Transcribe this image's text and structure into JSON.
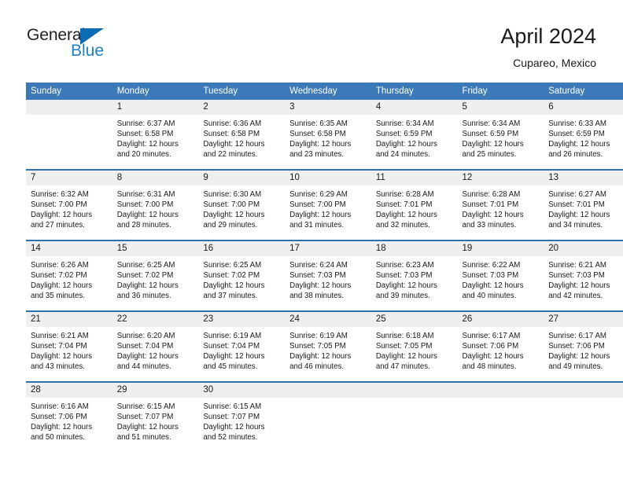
{
  "logo": {
    "word1": "General",
    "word2": "Blue",
    "triangle_color": "#0b6cb5",
    "word2_color": "#1c81c9"
  },
  "header": {
    "title": "April 2024",
    "subtitle": "Cupareo, Mexico",
    "accent_color": "#3b79b8",
    "daynum_band_color": "#efefef",
    "row_separator_color": "#2f6fae"
  },
  "calendar": {
    "weekday_headers": [
      "Sunday",
      "Monday",
      "Tuesday",
      "Wednesday",
      "Thursday",
      "Friday",
      "Saturday"
    ],
    "labels": {
      "sunrise": "Sunrise:",
      "sunset": "Sunset:",
      "daylight": "Daylight:"
    },
    "weeks": [
      [
        {
          "day": "",
          "empty": true
        },
        {
          "day": "1",
          "sunrise": "Sunrise: 6:37 AM",
          "sunset": "Sunset: 6:58 PM",
          "daylight_line1": "Daylight: 12 hours",
          "daylight_line2": "and 20 minutes."
        },
        {
          "day": "2",
          "sunrise": "Sunrise: 6:36 AM",
          "sunset": "Sunset: 6:58 PM",
          "daylight_line1": "Daylight: 12 hours",
          "daylight_line2": "and 22 minutes."
        },
        {
          "day": "3",
          "sunrise": "Sunrise: 6:35 AM",
          "sunset": "Sunset: 6:58 PM",
          "daylight_line1": "Daylight: 12 hours",
          "daylight_line2": "and 23 minutes."
        },
        {
          "day": "4",
          "sunrise": "Sunrise: 6:34 AM",
          "sunset": "Sunset: 6:59 PM",
          "daylight_line1": "Daylight: 12 hours",
          "daylight_line2": "and 24 minutes."
        },
        {
          "day": "5",
          "sunrise": "Sunrise: 6:34 AM",
          "sunset": "Sunset: 6:59 PM",
          "daylight_line1": "Daylight: 12 hours",
          "daylight_line2": "and 25 minutes."
        },
        {
          "day": "6",
          "sunrise": "Sunrise: 6:33 AM",
          "sunset": "Sunset: 6:59 PM",
          "daylight_line1": "Daylight: 12 hours",
          "daylight_line2": "and 26 minutes."
        }
      ],
      [
        {
          "day": "7",
          "sunrise": "Sunrise: 6:32 AM",
          "sunset": "Sunset: 7:00 PM",
          "daylight_line1": "Daylight: 12 hours",
          "daylight_line2": "and 27 minutes."
        },
        {
          "day": "8",
          "sunrise": "Sunrise: 6:31 AM",
          "sunset": "Sunset: 7:00 PM",
          "daylight_line1": "Daylight: 12 hours",
          "daylight_line2": "and 28 minutes."
        },
        {
          "day": "9",
          "sunrise": "Sunrise: 6:30 AM",
          "sunset": "Sunset: 7:00 PM",
          "daylight_line1": "Daylight: 12 hours",
          "daylight_line2": "and 29 minutes."
        },
        {
          "day": "10",
          "sunrise": "Sunrise: 6:29 AM",
          "sunset": "Sunset: 7:00 PM",
          "daylight_line1": "Daylight: 12 hours",
          "daylight_line2": "and 31 minutes."
        },
        {
          "day": "11",
          "sunrise": "Sunrise: 6:28 AM",
          "sunset": "Sunset: 7:01 PM",
          "daylight_line1": "Daylight: 12 hours",
          "daylight_line2": "and 32 minutes."
        },
        {
          "day": "12",
          "sunrise": "Sunrise: 6:28 AM",
          "sunset": "Sunset: 7:01 PM",
          "daylight_line1": "Daylight: 12 hours",
          "daylight_line2": "and 33 minutes."
        },
        {
          "day": "13",
          "sunrise": "Sunrise: 6:27 AM",
          "sunset": "Sunset: 7:01 PM",
          "daylight_line1": "Daylight: 12 hours",
          "daylight_line2": "and 34 minutes."
        }
      ],
      [
        {
          "day": "14",
          "sunrise": "Sunrise: 6:26 AM",
          "sunset": "Sunset: 7:02 PM",
          "daylight_line1": "Daylight: 12 hours",
          "daylight_line2": "and 35 minutes."
        },
        {
          "day": "15",
          "sunrise": "Sunrise: 6:25 AM",
          "sunset": "Sunset: 7:02 PM",
          "daylight_line1": "Daylight: 12 hours",
          "daylight_line2": "and 36 minutes."
        },
        {
          "day": "16",
          "sunrise": "Sunrise: 6:25 AM",
          "sunset": "Sunset: 7:02 PM",
          "daylight_line1": "Daylight: 12 hours",
          "daylight_line2": "and 37 minutes."
        },
        {
          "day": "17",
          "sunrise": "Sunrise: 6:24 AM",
          "sunset": "Sunset: 7:03 PM",
          "daylight_line1": "Daylight: 12 hours",
          "daylight_line2": "and 38 minutes."
        },
        {
          "day": "18",
          "sunrise": "Sunrise: 6:23 AM",
          "sunset": "Sunset: 7:03 PM",
          "daylight_line1": "Daylight: 12 hours",
          "daylight_line2": "and 39 minutes."
        },
        {
          "day": "19",
          "sunrise": "Sunrise: 6:22 AM",
          "sunset": "Sunset: 7:03 PM",
          "daylight_line1": "Daylight: 12 hours",
          "daylight_line2": "and 40 minutes."
        },
        {
          "day": "20",
          "sunrise": "Sunrise: 6:21 AM",
          "sunset": "Sunset: 7:03 PM",
          "daylight_line1": "Daylight: 12 hours",
          "daylight_line2": "and 42 minutes."
        }
      ],
      [
        {
          "day": "21",
          "sunrise": "Sunrise: 6:21 AM",
          "sunset": "Sunset: 7:04 PM",
          "daylight_line1": "Daylight: 12 hours",
          "daylight_line2": "and 43 minutes."
        },
        {
          "day": "22",
          "sunrise": "Sunrise: 6:20 AM",
          "sunset": "Sunset: 7:04 PM",
          "daylight_line1": "Daylight: 12 hours",
          "daylight_line2": "and 44 minutes."
        },
        {
          "day": "23",
          "sunrise": "Sunrise: 6:19 AM",
          "sunset": "Sunset: 7:04 PM",
          "daylight_line1": "Daylight: 12 hours",
          "daylight_line2": "and 45 minutes."
        },
        {
          "day": "24",
          "sunrise": "Sunrise: 6:19 AM",
          "sunset": "Sunset: 7:05 PM",
          "daylight_line1": "Daylight: 12 hours",
          "daylight_line2": "and 46 minutes."
        },
        {
          "day": "25",
          "sunrise": "Sunrise: 6:18 AM",
          "sunset": "Sunset: 7:05 PM",
          "daylight_line1": "Daylight: 12 hours",
          "daylight_line2": "and 47 minutes."
        },
        {
          "day": "26",
          "sunrise": "Sunrise: 6:17 AM",
          "sunset": "Sunset: 7:06 PM",
          "daylight_line1": "Daylight: 12 hours",
          "daylight_line2": "and 48 minutes."
        },
        {
          "day": "27",
          "sunrise": "Sunrise: 6:17 AM",
          "sunset": "Sunset: 7:06 PM",
          "daylight_line1": "Daylight: 12 hours",
          "daylight_line2": "and 49 minutes."
        }
      ],
      [
        {
          "day": "28",
          "sunrise": "Sunrise: 6:16 AM",
          "sunset": "Sunset: 7:06 PM",
          "daylight_line1": "Daylight: 12 hours",
          "daylight_line2": "and 50 minutes."
        },
        {
          "day": "29",
          "sunrise": "Sunrise: 6:15 AM",
          "sunset": "Sunset: 7:07 PM",
          "daylight_line1": "Daylight: 12 hours",
          "daylight_line2": "and 51 minutes."
        },
        {
          "day": "30",
          "sunrise": "Sunrise: 6:15 AM",
          "sunset": "Sunset: 7:07 PM",
          "daylight_line1": "Daylight: 12 hours",
          "daylight_line2": "and 52 minutes."
        },
        {
          "day": "",
          "empty": true
        },
        {
          "day": "",
          "empty": true
        },
        {
          "day": "",
          "empty": true
        },
        {
          "day": "",
          "empty": true
        }
      ]
    ]
  }
}
